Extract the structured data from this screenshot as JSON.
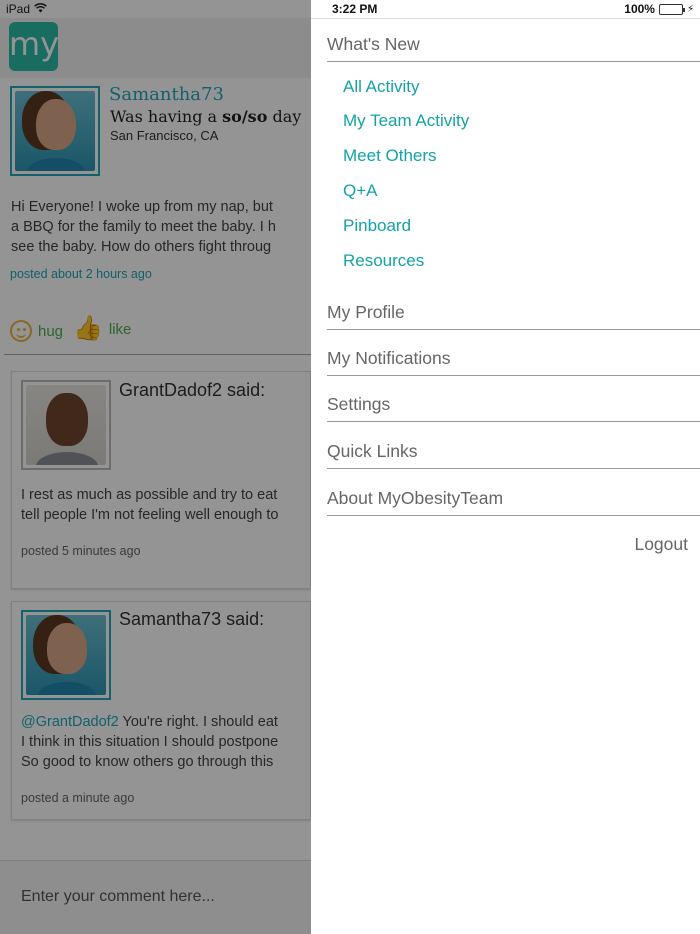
{
  "status_bar": {
    "device": "iPad",
    "time": "3:22 PM",
    "battery": "100%"
  },
  "feed": {
    "logo_text": "my",
    "post": {
      "username": "Samantha73",
      "mood_prefix": "Was having a ",
      "mood_value": "so/so",
      "mood_suffix": " day",
      "location": "San Francisco, CA",
      "text_lines": [
        "Hi Everyone! I woke up from my nap, but",
        "a BBQ for the family to meet the baby.  I h",
        "see the baby.  How do others fight throug"
      ],
      "posted": "posted about 2 hours ago"
    },
    "reactions": {
      "hug": "hug",
      "like": "like"
    },
    "comments": [
      {
        "author": "GrantDadof2 said:",
        "text_lines": [
          "I rest as much as possible and try to eat",
          "tell people I'm not feeling well enough to"
        ],
        "posted": "posted 5 minutes ago"
      },
      {
        "author": "Samantha73 said:",
        "mention": "@GrantDadof2",
        "text_first": " You're right. I should eat",
        "text_lines": [
          "I think in this situation I should postpone",
          "So good to know others go through this"
        ],
        "posted": "posted a  minute ago"
      }
    ],
    "comment_placeholder": "Enter your comment here..."
  },
  "menu": {
    "whats_new": "What's New",
    "sub_items": [
      "All Activity",
      "My Team Activity",
      "Meet Others",
      "Q+A",
      "Pinboard",
      "Resources"
    ],
    "sections": [
      "My Profile",
      "My Notifications",
      "Settings",
      "Quick Links",
      "About MyObesityTeam"
    ],
    "logout": "Logout"
  },
  "colors": {
    "accent_teal": "#13a3a6",
    "logo_green": "#2bbba5",
    "battery_green": "#35c24b"
  }
}
